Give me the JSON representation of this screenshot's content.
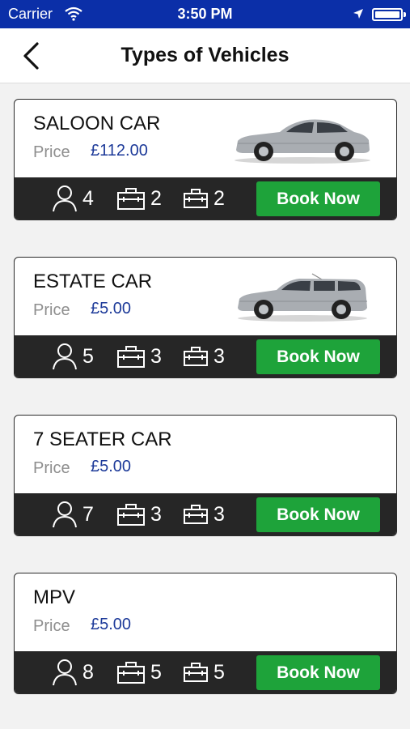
{
  "status_bar": {
    "carrier": "Carrier",
    "time": "3:50 PM",
    "battery_percent": 100
  },
  "nav": {
    "title": "Types of Vehicles",
    "back_icon": "chevron-left-icon"
  },
  "colors": {
    "status_bar": "#0b2fa8",
    "book_button": "#1ea33a",
    "price_value": "#1d3a99",
    "card_bar": "#262626"
  },
  "vehicles": [
    {
      "name": "SALOON CAR",
      "price_label": "Price",
      "price": "£112.00",
      "passengers": "4",
      "luggage": "2",
      "hand_luggage": "2",
      "book_label": "Book Now",
      "image": "saloon-car"
    },
    {
      "name": "ESTATE CAR",
      "price_label": "Price",
      "price": "£5.00",
      "passengers": "5",
      "luggage": "3",
      "hand_luggage": "3",
      "book_label": "Book Now",
      "image": "estate-car"
    },
    {
      "name": "7 SEATER CAR",
      "price_label": "Price",
      "price": "£5.00",
      "passengers": "7",
      "luggage": "3",
      "hand_luggage": "3",
      "book_label": "Book Now",
      "image": null
    },
    {
      "name": "MPV",
      "price_label": "Price",
      "price": "£5.00",
      "passengers": "8",
      "luggage": "5",
      "hand_luggage": "5",
      "book_label": "Book Now",
      "image": null
    }
  ]
}
